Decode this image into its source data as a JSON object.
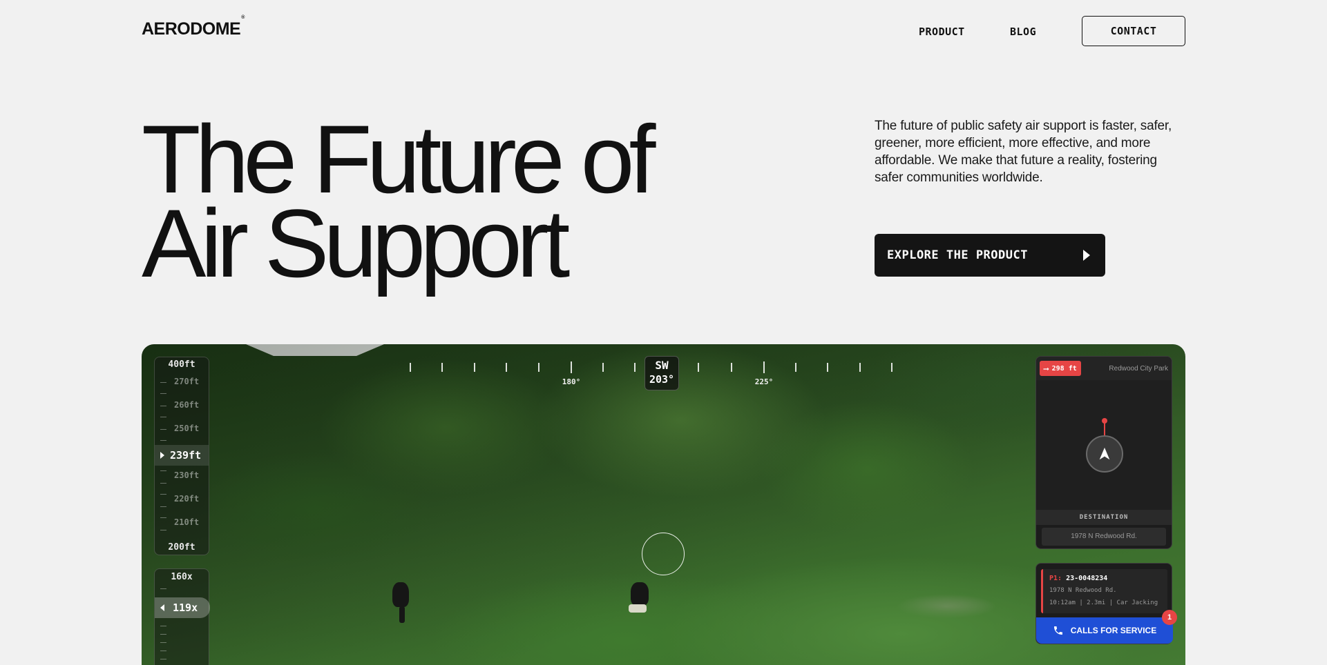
{
  "nav": {
    "logo": "AERODOME",
    "logo_mark": "®",
    "links": [
      "PRODUCT",
      "BLOG"
    ],
    "contact_label": "CONTACT"
  },
  "hero": {
    "title_line1": "The Future of",
    "title_line2": "Air Support",
    "intro": "The future of public safety air support is faster, safer, greener, more efficient, more effective, and more affordable. We make that future a reality, fostering safer communities worldwide.",
    "cta_label": "EXPLORE THE PRODUCT"
  },
  "hud": {
    "altitude": {
      "max": "400ft",
      "min": "200ft",
      "ticks": [
        "270ft",
        "260ft",
        "250ft",
        "230ft",
        "220ft",
        "210ft"
      ],
      "current": "239ft"
    },
    "zoom": {
      "max": "160x",
      "current": "119x"
    },
    "compass": {
      "direction": "SW",
      "heading": "203°",
      "labels": [
        "180°",
        "225°"
      ]
    },
    "map": {
      "distance": "298 ft",
      "location": "Redwood City Park",
      "destination_label": "DESTINATION",
      "destination": "1978 N Redwood Rd."
    },
    "call": {
      "priority": "P1:",
      "id": "23-0048234",
      "address": "1978 N Redwood Rd.",
      "details": "10:12am | 2.3mi | Car Jacking",
      "button_label": "CALLS FOR SERVICE",
      "count": "1"
    },
    "colors": {
      "alert_red": "#e64545",
      "service_blue": "#1f4fd6"
    }
  }
}
